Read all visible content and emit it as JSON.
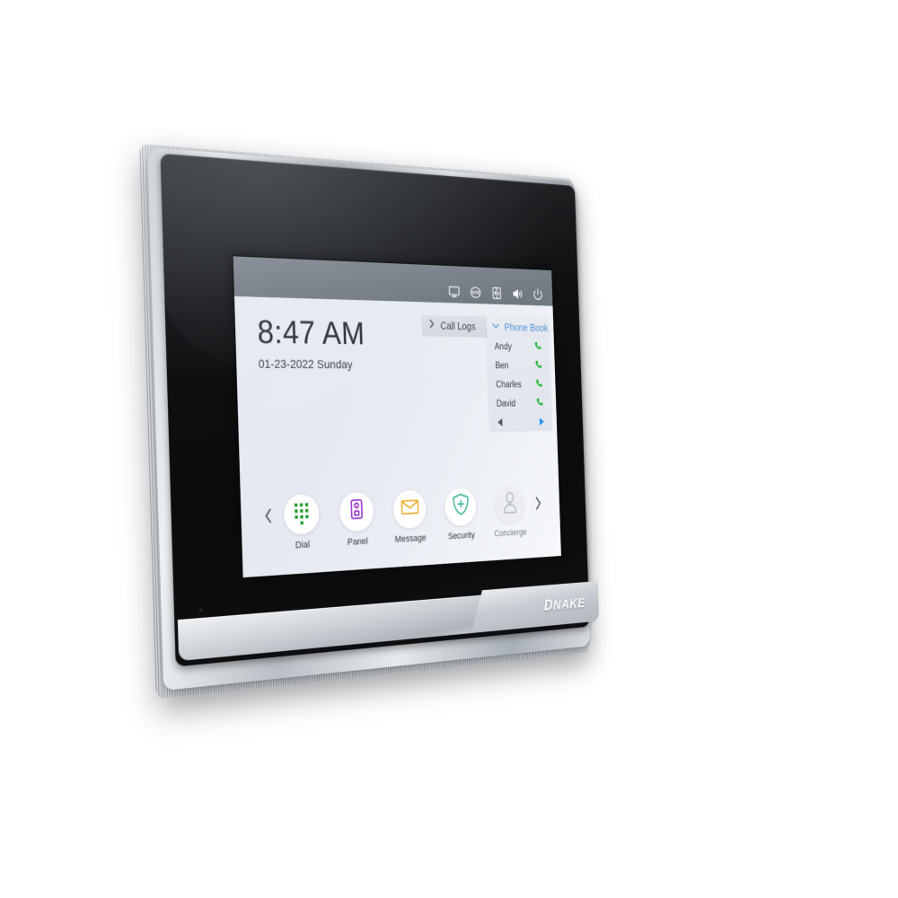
{
  "device": {
    "brand": "DNAKE",
    "brand_first_letter": "D",
    "brand_rest": "NAKE",
    "type": "indoor-monitor"
  },
  "status_bar": {
    "icons": [
      {
        "name": "monitor-icon",
        "label": "Monitor"
      },
      {
        "name": "sos-icon",
        "label": "SOS"
      },
      {
        "name": "elevator-icon",
        "label": "Elevator"
      },
      {
        "name": "volume-icon",
        "label": "Volume"
      },
      {
        "name": "power-icon",
        "label": "Power"
      }
    ]
  },
  "clock": {
    "time": "8:47 AM",
    "date": "01-23-2022 Sunday"
  },
  "call_logs": {
    "label": "Call Logs",
    "chevron": "chevron-right",
    "expanded": false
  },
  "phone_book": {
    "label": "Phone Book",
    "chevron": "chevron-down",
    "expanded": true,
    "accent_color": "#4a90d9",
    "call_icon_color": "#22b83c",
    "contacts": [
      {
        "name": "Andy",
        "action": "call"
      },
      {
        "name": "Ben",
        "action": "call"
      },
      {
        "name": "Charles",
        "action": "call"
      },
      {
        "name": "David",
        "action": "call"
      }
    ],
    "pager": {
      "prev": "◀",
      "next": "▶",
      "prev_color": "#4c5158",
      "next_color": "#1e93f0"
    }
  },
  "dock": {
    "prev_arrow": "‹",
    "next_arrow": "›",
    "apps": [
      {
        "label": "Dial",
        "icon": "dialpad-icon",
        "color": "#22a02c",
        "enabled": true
      },
      {
        "label": "Panel",
        "icon": "door-station-icon",
        "color": "#8a1fc4",
        "enabled": true
      },
      {
        "label": "Message",
        "icon": "envelope-icon",
        "color": "#eaa81e",
        "enabled": true
      },
      {
        "label": "Security",
        "icon": "shield-plus-icon",
        "color": "#2fb08a",
        "enabled": true
      },
      {
        "label": "Concierge",
        "icon": "person-icon",
        "color": "#b4bac2",
        "enabled": false
      }
    ]
  },
  "colors": {
    "status_bar": "#6e7680",
    "screen_bg": "#e2e6ef",
    "glass": "#101113",
    "chassis": "#cfd4d9"
  }
}
